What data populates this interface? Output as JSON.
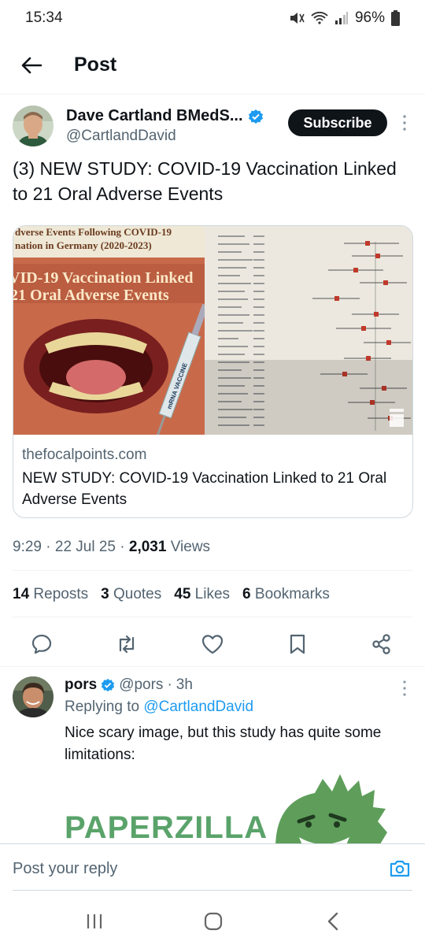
{
  "status_bar": {
    "time": "15:34",
    "battery": "96%"
  },
  "header": {
    "title": "Post"
  },
  "post": {
    "author_name": "Dave Cartland BMedS...",
    "author_handle": "@CartlandDavid",
    "subscribe_label": "Subscribe",
    "text": "(3) NEW STUDY: COVID-19 Vaccination Linked to 21 Oral Adverse Events",
    "card": {
      "image_heading_1": "dverse Events Following COVID-19",
      "image_heading_2": "nation in Germany (2020-2023)",
      "image_overlay_1": "VID-19 Vaccination Linked",
      "image_overlay_2": "21 Oral Adverse Events",
      "syringe_label": "mRNA VACCINE",
      "domain": "thefocalpoints.com",
      "title": "NEW STUDY: COVID-19 Vaccination Linked to 21 Oral Adverse Events"
    },
    "time": "9:29",
    "date": "22 Jul 25",
    "views_count": "2,031",
    "views_label": "Views",
    "stats": [
      {
        "count": "14",
        "label": "Reposts"
      },
      {
        "count": "3",
        "label": "Quotes"
      },
      {
        "count": "45",
        "label": "Likes"
      },
      {
        "count": "6",
        "label": "Bookmarks"
      }
    ]
  },
  "reply": {
    "name": "pors",
    "handle": "@pors",
    "age": "3h",
    "replying_prefix": "Replying to",
    "replying_to": "@CartlandDavid",
    "text": "Nice scary image, but this study has quite some limitations:",
    "image_text": "PAPERZILLA"
  },
  "composer": {
    "placeholder": "Post your reply"
  },
  "colors": {
    "accent": "#1d9bf0",
    "text": "#0f1419",
    "muted": "#536471",
    "brand_green": "#5aa36a"
  }
}
